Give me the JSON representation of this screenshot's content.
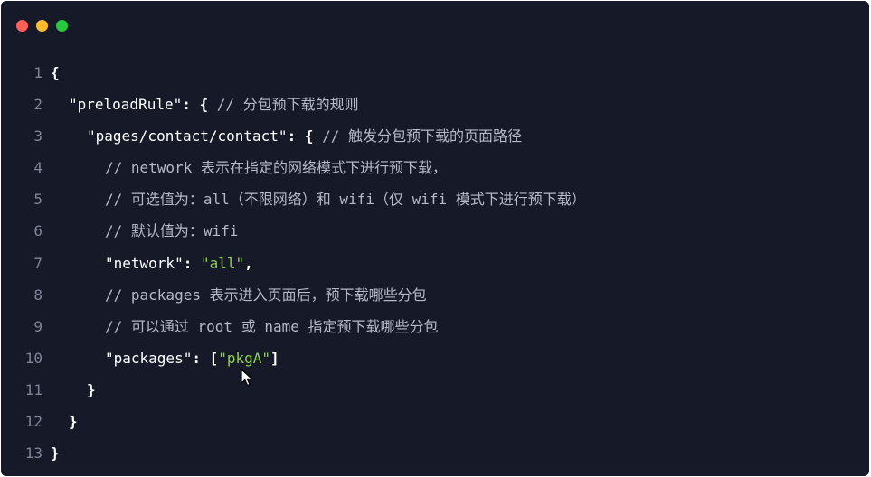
{
  "window": {
    "controls": [
      {
        "name": "close",
        "color": "#fe5f57"
      },
      {
        "name": "minimize",
        "color": "#febc2e"
      },
      {
        "name": "maximize",
        "color": "#28c840"
      }
    ]
  },
  "code": {
    "colors": {
      "background": "#161928",
      "string": "#8fd14f",
      "comment": "#b6bac8",
      "line_number": "#7f8497"
    },
    "lines": [
      {
        "no": "1",
        "indent": 0,
        "tokens": [
          {
            "t": "punc",
            "v": "{"
          }
        ]
      },
      {
        "no": "2",
        "indent": 1,
        "tokens": [
          {
            "t": "key",
            "v": "\"preloadRule\""
          },
          {
            "t": "punc",
            "v": ": { "
          },
          {
            "t": "comment",
            "v": "// 分包预下载的规则"
          }
        ]
      },
      {
        "no": "3",
        "indent": 2,
        "tokens": [
          {
            "t": "key",
            "v": "\"pages/contact/contact\""
          },
          {
            "t": "punc",
            "v": ": { "
          },
          {
            "t": "comment",
            "v": "// 触发分包预下载的页面路径"
          }
        ]
      },
      {
        "no": "4",
        "indent": 3,
        "tokens": [
          {
            "t": "comment",
            "v": "// network 表示在指定的网络模式下进行预下载，"
          }
        ]
      },
      {
        "no": "5",
        "indent": 3,
        "tokens": [
          {
            "t": "comment",
            "v": "// 可选值为：all（不限网络）和 wifi（仅 wifi 模式下进行预下载）"
          }
        ]
      },
      {
        "no": "6",
        "indent": 3,
        "tokens": [
          {
            "t": "comment",
            "v": "// 默认值为：wifi"
          }
        ]
      },
      {
        "no": "7",
        "indent": 3,
        "tokens": [
          {
            "t": "key",
            "v": "\"network\""
          },
          {
            "t": "punc",
            "v": ": "
          },
          {
            "t": "str",
            "v": "\"all\""
          },
          {
            "t": "punc",
            "v": ","
          }
        ]
      },
      {
        "no": "8",
        "indent": 3,
        "tokens": [
          {
            "t": "comment",
            "v": "// packages 表示进入页面后，预下载哪些分包"
          }
        ]
      },
      {
        "no": "9",
        "indent": 3,
        "tokens": [
          {
            "t": "comment",
            "v": "// 可以通过 root 或 name 指定预下载哪些分包"
          }
        ]
      },
      {
        "no": "10",
        "indent": 3,
        "tokens": [
          {
            "t": "key",
            "v": "\"packages\""
          },
          {
            "t": "punc",
            "v": ": ["
          },
          {
            "t": "str",
            "v": "\"pkgA\""
          },
          {
            "t": "punc",
            "v": "]"
          }
        ]
      },
      {
        "no": "11",
        "indent": 2,
        "tokens": [
          {
            "t": "punc",
            "v": "}"
          }
        ]
      },
      {
        "no": "12",
        "indent": 1,
        "tokens": [
          {
            "t": "punc",
            "v": "}"
          }
        ]
      },
      {
        "no": "13",
        "indent": 0,
        "tokens": [
          {
            "t": "punc",
            "v": "}"
          }
        ]
      }
    ]
  },
  "cursor": {
    "icon": "mouse-pointer-icon"
  }
}
